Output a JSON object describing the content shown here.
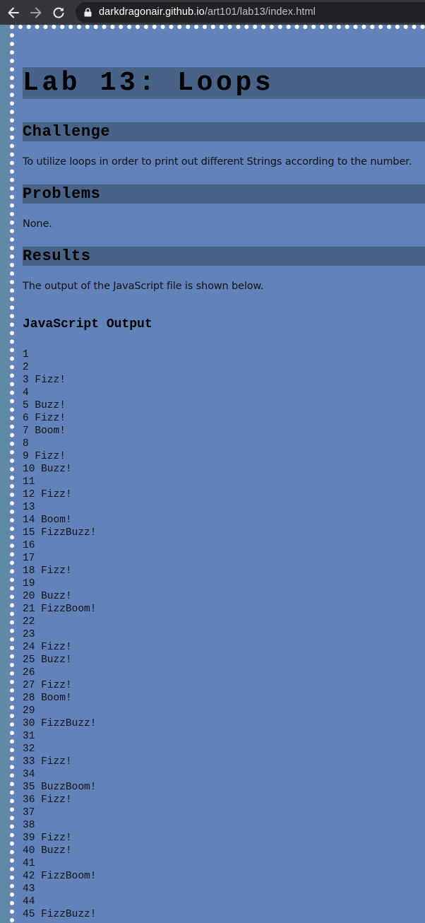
{
  "browser": {
    "url_host": "darkdragonair.github.io",
    "url_path": "/art101/lab13/index.html"
  },
  "page": {
    "title": "Lab 13:  Loops",
    "sections": [
      {
        "heading": "Challenge",
        "text": "To utilize loops in order to print out different Strings according to the number."
      },
      {
        "heading": "Problems",
        "text": "None."
      },
      {
        "heading": "Results",
        "text": "The output of the JavaScript file is shown below."
      }
    ],
    "output_title": "JavaScript Output",
    "output_lines": [
      "1",
      "2",
      "3 Fizz!",
      "4",
      "5 Buzz!",
      "6 Fizz!",
      "7 Boom!",
      "8",
      "9 Fizz!",
      "10 Buzz!",
      "11",
      "12 Fizz!",
      "13",
      "14 Boom!",
      "15 FizzBuzz!",
      "16",
      "17",
      "18 Fizz!",
      "19",
      "20 Buzz!",
      "21 FizzBoom!",
      "22",
      "23",
      "24 Fizz!",
      "25 Buzz!",
      "26",
      "27 Fizz!",
      "28 Boom!",
      "29",
      "30 FizzBuzz!",
      "31",
      "32",
      "33 Fizz!",
      "34",
      "35 BuzzBoom!",
      "36 Fizz!",
      "37",
      "38",
      "39 Fizz!",
      "40 Buzz!",
      "41",
      "42 FizzBoom!",
      "43",
      "44",
      "45 FizzBuzz!"
    ]
  },
  "colors": {
    "page_background": "#6183b9",
    "heading_bar": "#486288",
    "left_margin": "#5e8aa8",
    "browser_chrome": "#35363a"
  },
  "icons": {
    "back": "arrow-left-icon",
    "forward": "arrow-right-icon",
    "reload": "reload-icon",
    "security": "lock-icon"
  }
}
